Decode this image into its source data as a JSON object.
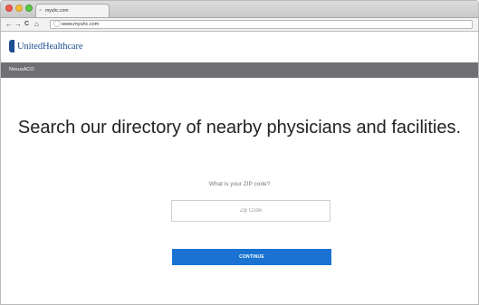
{
  "browser": {
    "tab_title": "myuhc.com",
    "tab_close": "×",
    "url": "www.myuhc.com",
    "nav": {
      "back": "←",
      "forward": "→",
      "reload": "C",
      "home": "⌂"
    },
    "traffic_light_colors": {
      "close": "#ee5a52",
      "minimize": "#f5bd3b",
      "zoom": "#5ac945"
    }
  },
  "site": {
    "logo_text": "UnitedHealthcare",
    "brand_color": "#1b4d8f",
    "nav_brand": "NexusACO"
  },
  "main": {
    "headline": "Search our directory of nearby physicians and facilities.",
    "zip_label": "What is your ZIP code?",
    "zip_placeholder": "Zip Code",
    "zip_value": "",
    "continue_label": "CONTINUE",
    "button_color": "#1a73d2"
  }
}
